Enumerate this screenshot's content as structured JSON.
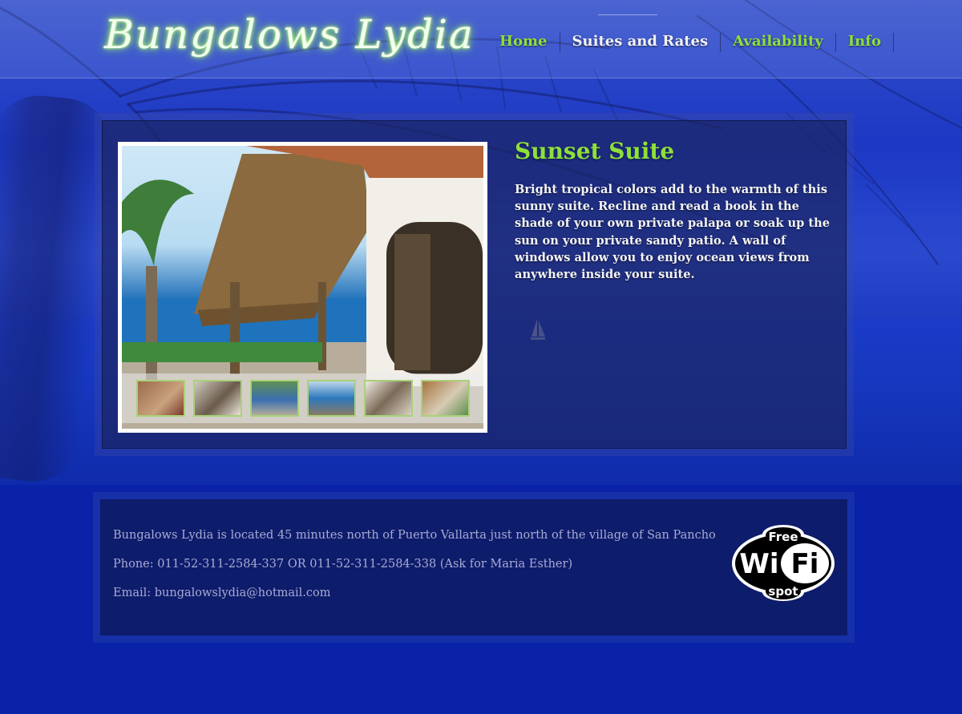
{
  "site": {
    "logo_text": "Bungalows Lydia"
  },
  "nav": {
    "items": [
      {
        "label": "Home",
        "style": "green"
      },
      {
        "label": "Suites and Rates",
        "style": "white"
      },
      {
        "label": "Availability",
        "style": "green"
      },
      {
        "label": "Info",
        "style": "green"
      }
    ]
  },
  "suite": {
    "title": "Sunset Suite",
    "description": "Bright tropical colors add to the warmth of this sunny suite. Recline and read a book in the shade of your own private palapa or soak up the sun on your private sandy patio. A wall of windows allow you to enjoy ocean views from anywhere inside your suite.",
    "thumbnail_count": 6
  },
  "footer": {
    "location": "Bungalows Lydia is located 45 minutes north of Puerto Vallarta just north of the village of San Pancho",
    "phone": "Phone: 011-52-311-2584-337 OR 011-52-311-2584-338 (Ask for Maria Esther)",
    "email": "Email: bungalowslydia@hotmail.com",
    "wifi_badge": {
      "top": "Free",
      "main_left": "Wi",
      "main_right": "Fi",
      "bottom": "spot"
    }
  },
  "colors": {
    "accent_green": "#8ee03a",
    "background_blue": "#0a22a8",
    "footer_text": "#a7acd2"
  }
}
